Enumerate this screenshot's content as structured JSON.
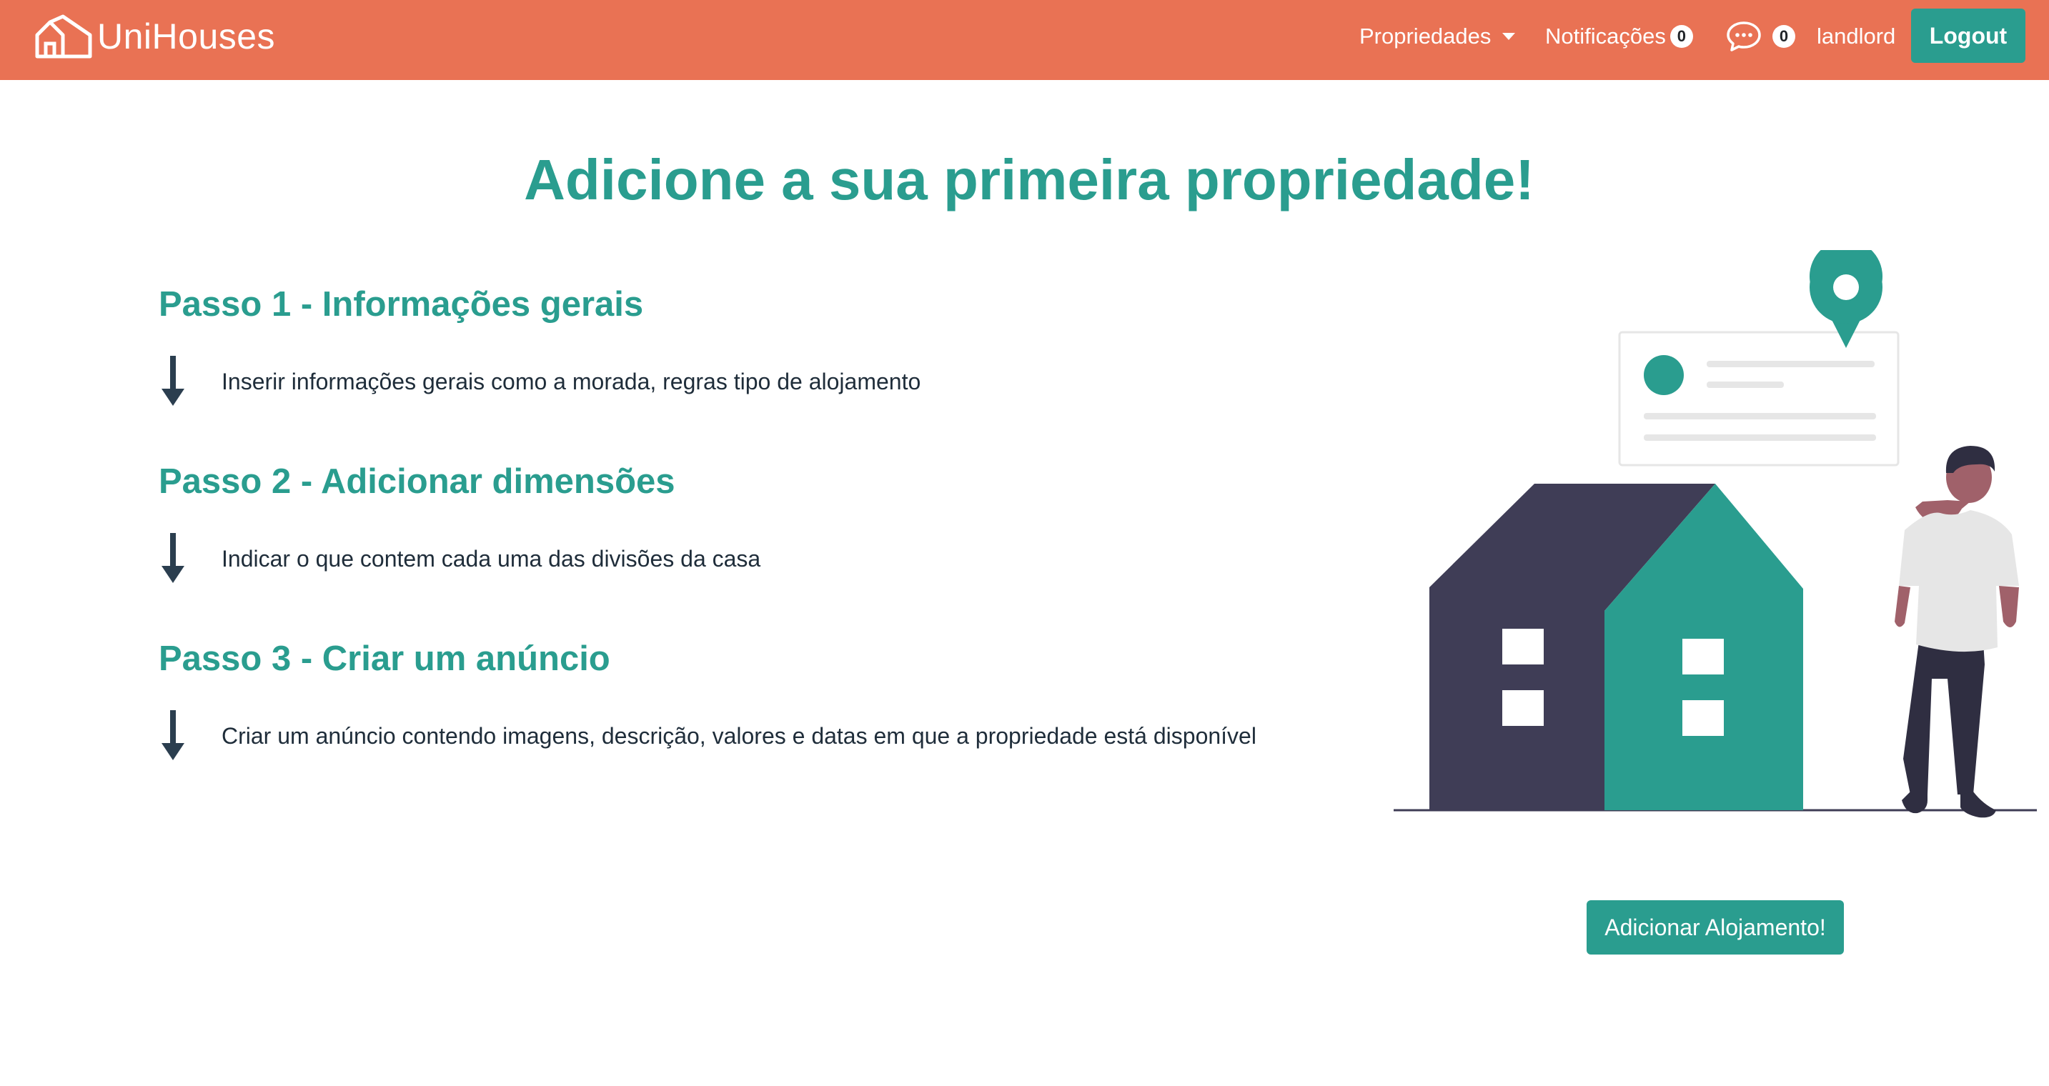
{
  "app": {
    "brand": "UniHouses"
  },
  "nav": {
    "properties_label": "Propriedades",
    "notifications_label": "Notificações",
    "notifications_count": "0",
    "messages_count": "0",
    "username": "landlord",
    "logout_label": "Logout"
  },
  "main": {
    "title": "Adicione a sua primeira propriedade!",
    "steps": [
      {
        "heading": "Passo 1 - Informações gerais",
        "description": "Inserir informações gerais como a morada, regras tipo de alojamento"
      },
      {
        "heading": "Passo 2 - Adicionar dimensões",
        "description": "Indicar o que contem cada uma das divisões da casa"
      },
      {
        "heading": "Passo 3 - Criar um anúncio",
        "description": "Criar um anúncio contendo imagens, descrição, valores e datas em que a propriedade está disponível"
      }
    ],
    "add_button_label": "Adicionar Alojamento!"
  },
  "colors": {
    "navbar": "#e97254",
    "accent": "#2a9d8f",
    "dark_house": "#3f3d56",
    "text": "#1f2d3a"
  },
  "icons": [
    "house-logo-icon",
    "chevron-down-icon",
    "chat-bubble-icon",
    "arrow-down-icon"
  ]
}
